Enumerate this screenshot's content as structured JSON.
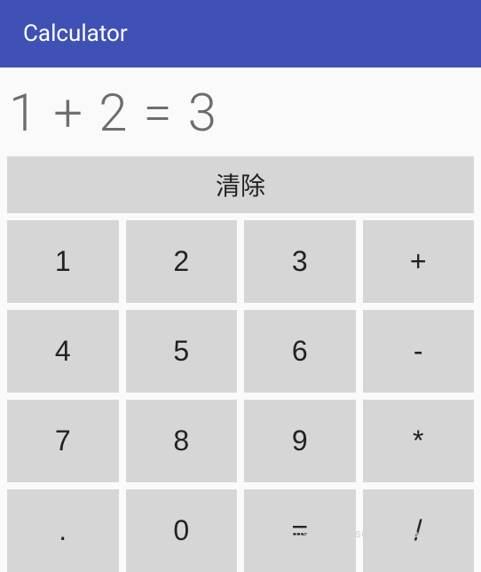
{
  "header": {
    "title": "Calculator"
  },
  "display": {
    "expression": "1 + 2 = 3"
  },
  "keypad": {
    "clear_label": "清除",
    "buttons": [
      {
        "label": "1",
        "name": "digit-1"
      },
      {
        "label": "2",
        "name": "digit-2"
      },
      {
        "label": "3",
        "name": "digit-3"
      },
      {
        "label": "+",
        "name": "op-plus"
      },
      {
        "label": "4",
        "name": "digit-4"
      },
      {
        "label": "5",
        "name": "digit-5"
      },
      {
        "label": "6",
        "name": "digit-6"
      },
      {
        "label": "-",
        "name": "op-minus"
      },
      {
        "label": "7",
        "name": "digit-7"
      },
      {
        "label": "8",
        "name": "digit-8"
      },
      {
        "label": "9",
        "name": "digit-9"
      },
      {
        "label": "*",
        "name": "op-multiply"
      },
      {
        "label": ".",
        "name": "decimal-point"
      },
      {
        "label": "0",
        "name": "digit-0"
      },
      {
        "label": "=",
        "name": "op-equals"
      },
      {
        "label": "/",
        "name": "op-divide"
      }
    ]
  },
  "watermark": {
    "text": "https://blog.csdn.net/Frankie_zhen"
  }
}
